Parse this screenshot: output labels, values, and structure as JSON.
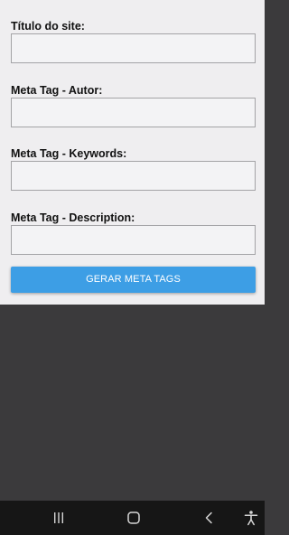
{
  "form": {
    "fields": [
      {
        "label": "Título do site:",
        "value": ""
      },
      {
        "label": "Meta Tag - Autor:",
        "value": ""
      },
      {
        "label": "Meta Tag - Keywords:",
        "value": ""
      },
      {
        "label": "Meta Tag - Description:",
        "value": ""
      }
    ],
    "generate_button_label": "GERAR META TAGS"
  },
  "colors": {
    "accent": "#3d9ee5",
    "form_background": "#efeef0",
    "content_background": "#3b3a3c",
    "nav_bar_background": "#161616"
  },
  "nav_bar": {
    "icons": [
      "recent-apps-icon",
      "home-icon",
      "back-icon",
      "accessibility-icon"
    ]
  }
}
